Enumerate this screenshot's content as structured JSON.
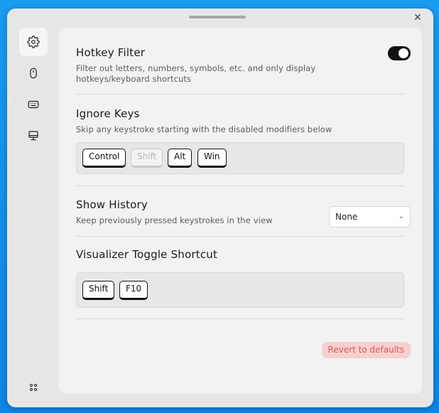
{
  "window": {
    "close_glyph": "✕"
  },
  "sidebar": {
    "items": [
      {
        "icon": "gear-icon",
        "active": true
      },
      {
        "icon": "mouse-icon",
        "active": false
      },
      {
        "icon": "keyboard-icon",
        "active": false
      },
      {
        "icon": "monitor-icon",
        "active": false
      }
    ],
    "bottom_icon": "apps-grid-icon"
  },
  "hotkey_filter": {
    "title": "Hotkey Filter",
    "description": "Filter out letters, numbers, symbols, etc. and only display hotkeys/keyboard shortcuts",
    "enabled": true
  },
  "ignore_keys": {
    "title": "Ignore Keys",
    "description": "Skip any keystroke starting with the disabled modifiers below",
    "keys": [
      {
        "label": "Control",
        "enabled": true
      },
      {
        "label": "Shift",
        "enabled": false
      },
      {
        "label": "Alt",
        "enabled": true
      },
      {
        "label": "Win",
        "enabled": true
      }
    ]
  },
  "show_history": {
    "title": "Show History",
    "description": "Keep previously pressed keystrokes in the view",
    "selected": "None"
  },
  "toggle_shortcut": {
    "title": "Visualizer Toggle Shortcut",
    "keys": [
      "Shift",
      "F10"
    ]
  },
  "revert_label": "Revert to defaults",
  "colors": {
    "accent": "#111111",
    "revert_bg": "#f7cfcf",
    "revert_text": "#d65b5b",
    "background": "#1a9cf0"
  }
}
